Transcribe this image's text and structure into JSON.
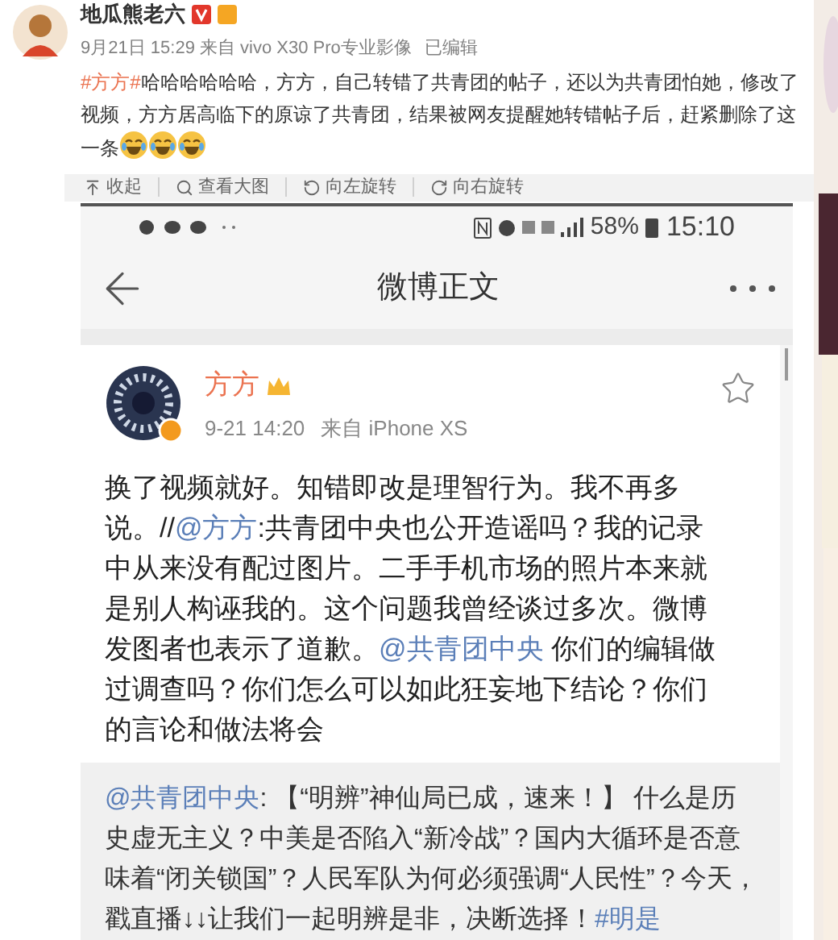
{
  "post": {
    "author": "地瓜熊老六",
    "meta": "9月21日 15:29 来自 vivo X30 Pro专业影像",
    "edited": "已编辑",
    "body": [
      {
        "kind": "hashtag",
        "text": "#方方#"
      },
      {
        "kind": "text",
        "text": "哈哈哈哈哈哈，方方，自己转错了共青团的帖子，还以为共青团怕她，修改了视频，方方居高临下的原谅了共青团，结果被网友提醒她转错帖子后，赶紧删除了这一条"
      },
      {
        "kind": "emoji"
      },
      {
        "kind": "emoji"
      },
      {
        "kind": "emoji"
      }
    ]
  },
  "image_toolbar": [
    {
      "kind": "collapse",
      "label": "收起"
    },
    {
      "kind": "zoom",
      "label": "查看大图"
    },
    {
      "kind": "rotate_left",
      "label": "向左旋转"
    },
    {
      "kind": "rotate_right",
      "label": "向右旋转"
    }
  ],
  "screenshot": {
    "status_bar": {
      "battery": "58%",
      "time": "15:10"
    },
    "nav": {
      "title": "微博正文"
    },
    "weibo": {
      "author": "方方",
      "time": "9-21 14:20",
      "source": "来自 iPhone XS",
      "body": [
        {
          "kind": "text",
          "text": "换了视频就好。知错即改是理智行为。我不再多说。//"
        },
        {
          "kind": "link",
          "text": "@方方"
        },
        {
          "kind": "text",
          "text": ":共青团中央也公开造谣吗？我的记录中从来没有配过图片。二手手机市场的照片本来就是别人构诬我的。这个问题我曾经谈过多次。微博发图者也表示了道歉。"
        },
        {
          "kind": "link",
          "text": "@共青团中央"
        },
        {
          "kind": "text",
          "text": " 你们的编辑做过调查吗？你们怎么可以如此狂妄地下结论？你们的言论和做法将会"
        }
      ],
      "retweet": [
        {
          "kind": "link",
          "text": "@共青团中央"
        },
        {
          "kind": "text",
          "text": ": 【“明辨”神仙局已成，速来！】 什么是历史虚无主义？中美是否陷入“新冷战”？国内大循环是否意味着“闭关锁国”？人民军队为何必须强调“人民性”？今天，戳直播↓↓让我们一起明辨是非，决断选择！"
        },
        {
          "kind": "link",
          "text": "#明是"
        }
      ]
    }
  }
}
